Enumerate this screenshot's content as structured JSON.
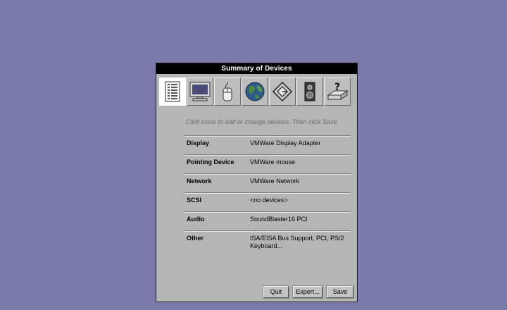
{
  "window": {
    "title": "Summary of Devices"
  },
  "toolbar": {
    "icons": [
      "summary-list-icon",
      "display-monitor-icon",
      "mouse-icon",
      "network-globe-icon",
      "scsi-diamond-icon",
      "audio-speaker-icon",
      "other-device-question-icon"
    ]
  },
  "hint": "Click icons to add or change devices.  Then click Save",
  "devices": [
    {
      "label": "Display",
      "value": "VMWare Display Adapter"
    },
    {
      "label": "Pointing Device",
      "value": "VMWare mouse"
    },
    {
      "label": "Network",
      "value": "VMWare Network"
    },
    {
      "label": "SCSI",
      "value": "<no devices>"
    },
    {
      "label": "Audio",
      "value": "SoundBlaster16 PCI"
    },
    {
      "label": "Other",
      "value": "ISA/EISA Bus Support, PCI, PS/2 Keyboard..."
    }
  ],
  "buttons": {
    "quit": "Quit",
    "expert": "Expert...",
    "save": "Save"
  }
}
